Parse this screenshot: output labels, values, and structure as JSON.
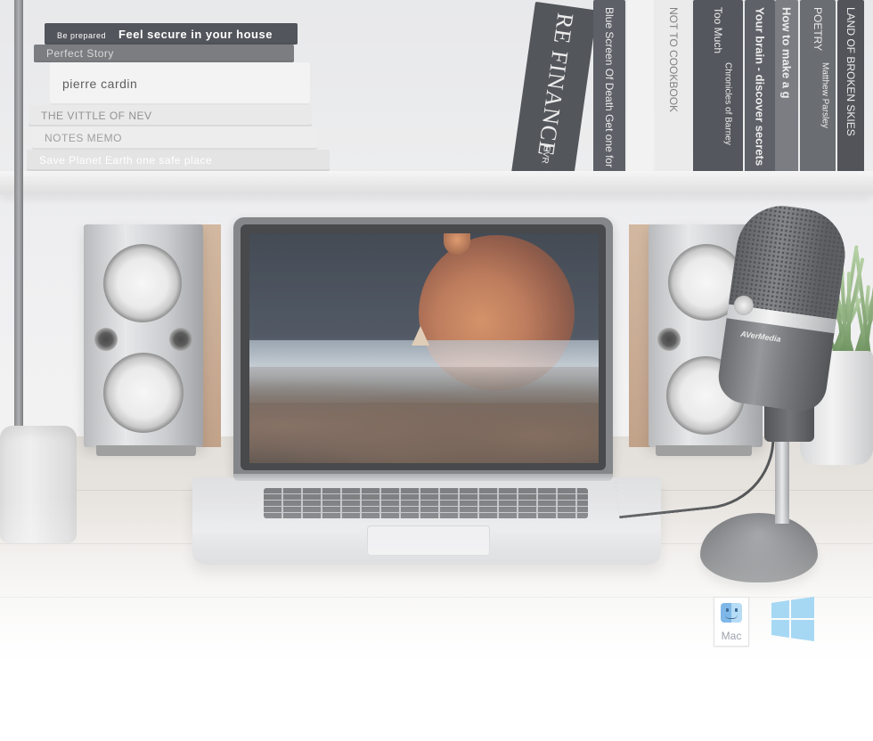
{
  "scene": {
    "left_books": [
      {
        "label": "Be prepared",
        "title": "Feel secure in your house",
        "color": "#2c3038",
        "text_color": "#ffffff"
      },
      {
        "label": "",
        "title": "Perfect Story",
        "color": "#5f6166",
        "text_color": "#cfd0d2"
      },
      {
        "label": "",
        "title": "pierre cardin",
        "color": "#f1f1f1",
        "text_color": "#3a3a3a"
      },
      {
        "label": "",
        "title": "THE VITTLE OF NEV",
        "color": "#e4e4e4",
        "text_color": "#7a7a7a"
      },
      {
        "label": "",
        "title": "NOTES MEMO",
        "color": "#e9e9e9",
        "text_color": "#8a8a8a"
      },
      {
        "label": "",
        "title": "Save Planet Earth one safe place",
        "color": "#dedede",
        "text_color": "#ffffff"
      }
    ],
    "right_books": [
      {
        "title": "RE FINANCE",
        "sub": "EVR",
        "color": "#2e3137",
        "text_color": "#e8e8e8"
      },
      {
        "title": "Blue Screen Of Death Get one for Free",
        "sub": "",
        "color": "#3a3e46",
        "text_color": "#e8e8e8"
      },
      {
        "title": "",
        "sub": "",
        "color": "#f0f0f0",
        "text_color": "#555555"
      },
      {
        "title": "NOT TO COOKBOOK",
        "sub": "",
        "color": "#e7e7e7",
        "text_color": "#666666"
      },
      {
        "title": "Too Much",
        "sub": "Chronicles of Barney",
        "color": "#2f333a",
        "text_color": "#e8e8e8"
      },
      {
        "title": "Your brain - discover secrets",
        "sub": "",
        "color": "#3b3f47",
        "text_color": "#e8e8e8"
      },
      {
        "title": "How to make a g",
        "sub": "",
        "color": "#5e6168",
        "text_color": "#e8e8e8"
      },
      {
        "title": "POETRY",
        "sub": "Matthew Parsley",
        "color": "#4a4d54",
        "text_color": "#e8e8e8"
      },
      {
        "title": "LAND OF BROKEN SKIES",
        "sub": "",
        "color": "#2c2f35",
        "text_color": "#e8e8e8"
      }
    ],
    "mic_brand": "AVerMedia"
  },
  "os_support": {
    "mac": {
      "label": "Mac",
      "icon": "mac-finder-icon"
    },
    "windows": {
      "label": "",
      "icon": "windows-logo-icon",
      "color": "#a6d8f4"
    }
  }
}
